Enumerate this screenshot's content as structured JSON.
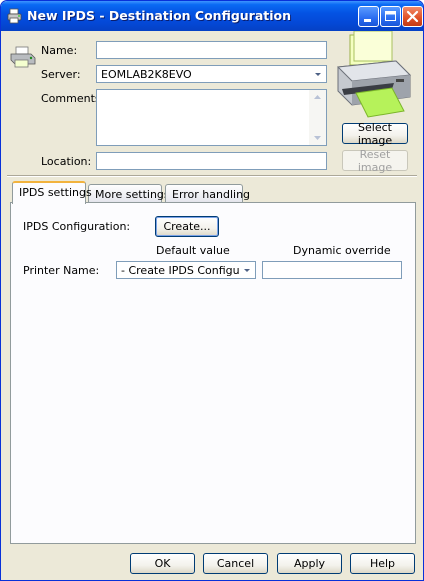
{
  "window": {
    "title": "New IPDS - Destination Configuration",
    "colors": {
      "titlebar": "#0453e3",
      "face": "#ece9d8",
      "close": "#e2532a"
    }
  },
  "form": {
    "name_label": "Name:",
    "name_value": "",
    "server_label": "Server:",
    "server_value": "EOMLAB2K8EVO",
    "comments_label": "Comments:",
    "comments_value": "",
    "location_label": "Location:",
    "location_value": ""
  },
  "image_panel": {
    "icon": "printer-icon",
    "select_label": "Select image",
    "reset_label": "Reset image"
  },
  "tabs": [
    {
      "label": "IPDS settings",
      "active": true
    },
    {
      "label": "More settings",
      "active": false
    },
    {
      "label": "Error handling",
      "active": false
    }
  ],
  "ipds": {
    "config_label": "IPDS Configuration:",
    "create_label": "Create...",
    "default_header": "Default value",
    "dynamic_header": "Dynamic override",
    "printer_name_label": "Printer Name:",
    "printer_default": "- Create IPDS Configurati...",
    "printer_dynamic": ""
  },
  "footer": {
    "ok": "OK",
    "cancel": "Cancel",
    "apply": "Apply",
    "help": "Help"
  }
}
